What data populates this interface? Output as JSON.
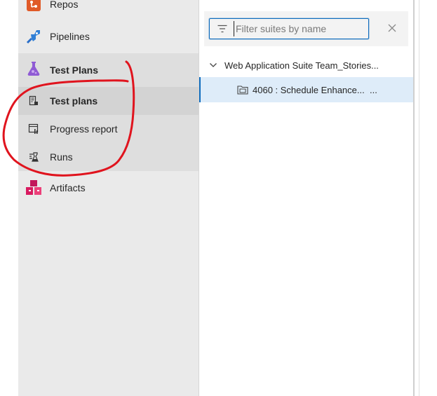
{
  "nav": {
    "repos": "Repos",
    "pipelines": "Pipelines",
    "test_plans": "Test Plans",
    "test_plans_sub": "Test plans",
    "progress_report": "Progress report",
    "runs": "Runs",
    "artifacts": "Artifacts"
  },
  "suites": {
    "filter_placeholder": "Filter suites by name",
    "filter_value": "",
    "root_suite": "Web Application Suite Team_Stories...",
    "child_suite": "4060 : Schedule Enhance...",
    "child_more": "..."
  },
  "colors": {
    "sidebar_bg": "#eaeaea",
    "selected_row": "#deecf9",
    "accent_blue": "#0f6cbd",
    "annotation_red": "#e0141e"
  }
}
